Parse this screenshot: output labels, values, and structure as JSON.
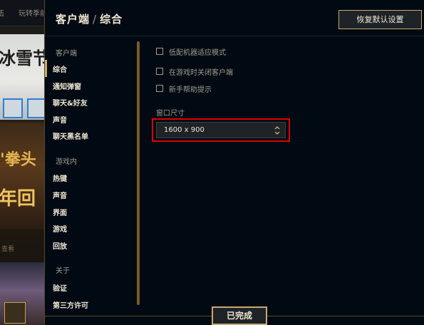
{
  "background": {
    "topbar_left": "伍",
    "topbar_text": "玩转季前",
    "panel_title": "冰雪节",
    "banner_line1": "'拳头",
    "banner_line2": "年回",
    "small_text": "查看",
    "colors": {
      "accent": "#c8aa6e",
      "blue": "#2e7fd1"
    }
  },
  "modal": {
    "breadcrumb": [
      "客户端",
      "综合"
    ],
    "separator": "/",
    "restore_button": "恢复默认设置",
    "done_button": "已完成"
  },
  "sidebar": {
    "groups": [
      {
        "label": "客户端",
        "items": [
          "综合",
          "通知弹窗",
          "聊天&好友",
          "声音",
          "聊天黑名单"
        ]
      },
      {
        "label": "游戏内",
        "items": [
          "热键",
          "声音",
          "界面",
          "游戏",
          "回放"
        ]
      },
      {
        "label": "关于",
        "items": [
          "验证",
          "第三方许可"
        ]
      }
    ],
    "active_item": "综合"
  },
  "content": {
    "checkboxes": [
      {
        "label": "低配机器适应模式",
        "checked": false
      },
      {
        "label": "在游戏时关闭客户端",
        "checked": false
      },
      {
        "label": "新手帮助提示",
        "checked": false
      }
    ],
    "window_size_label": "窗口尺寸",
    "window_size_value": "1600 x 900"
  },
  "colors": {
    "gold": "#c8aa6e",
    "text_light": "#f0e6d2",
    "text_muted": "#a09b8c",
    "modal_bg": "#010a13",
    "highlight": "#e00000"
  }
}
